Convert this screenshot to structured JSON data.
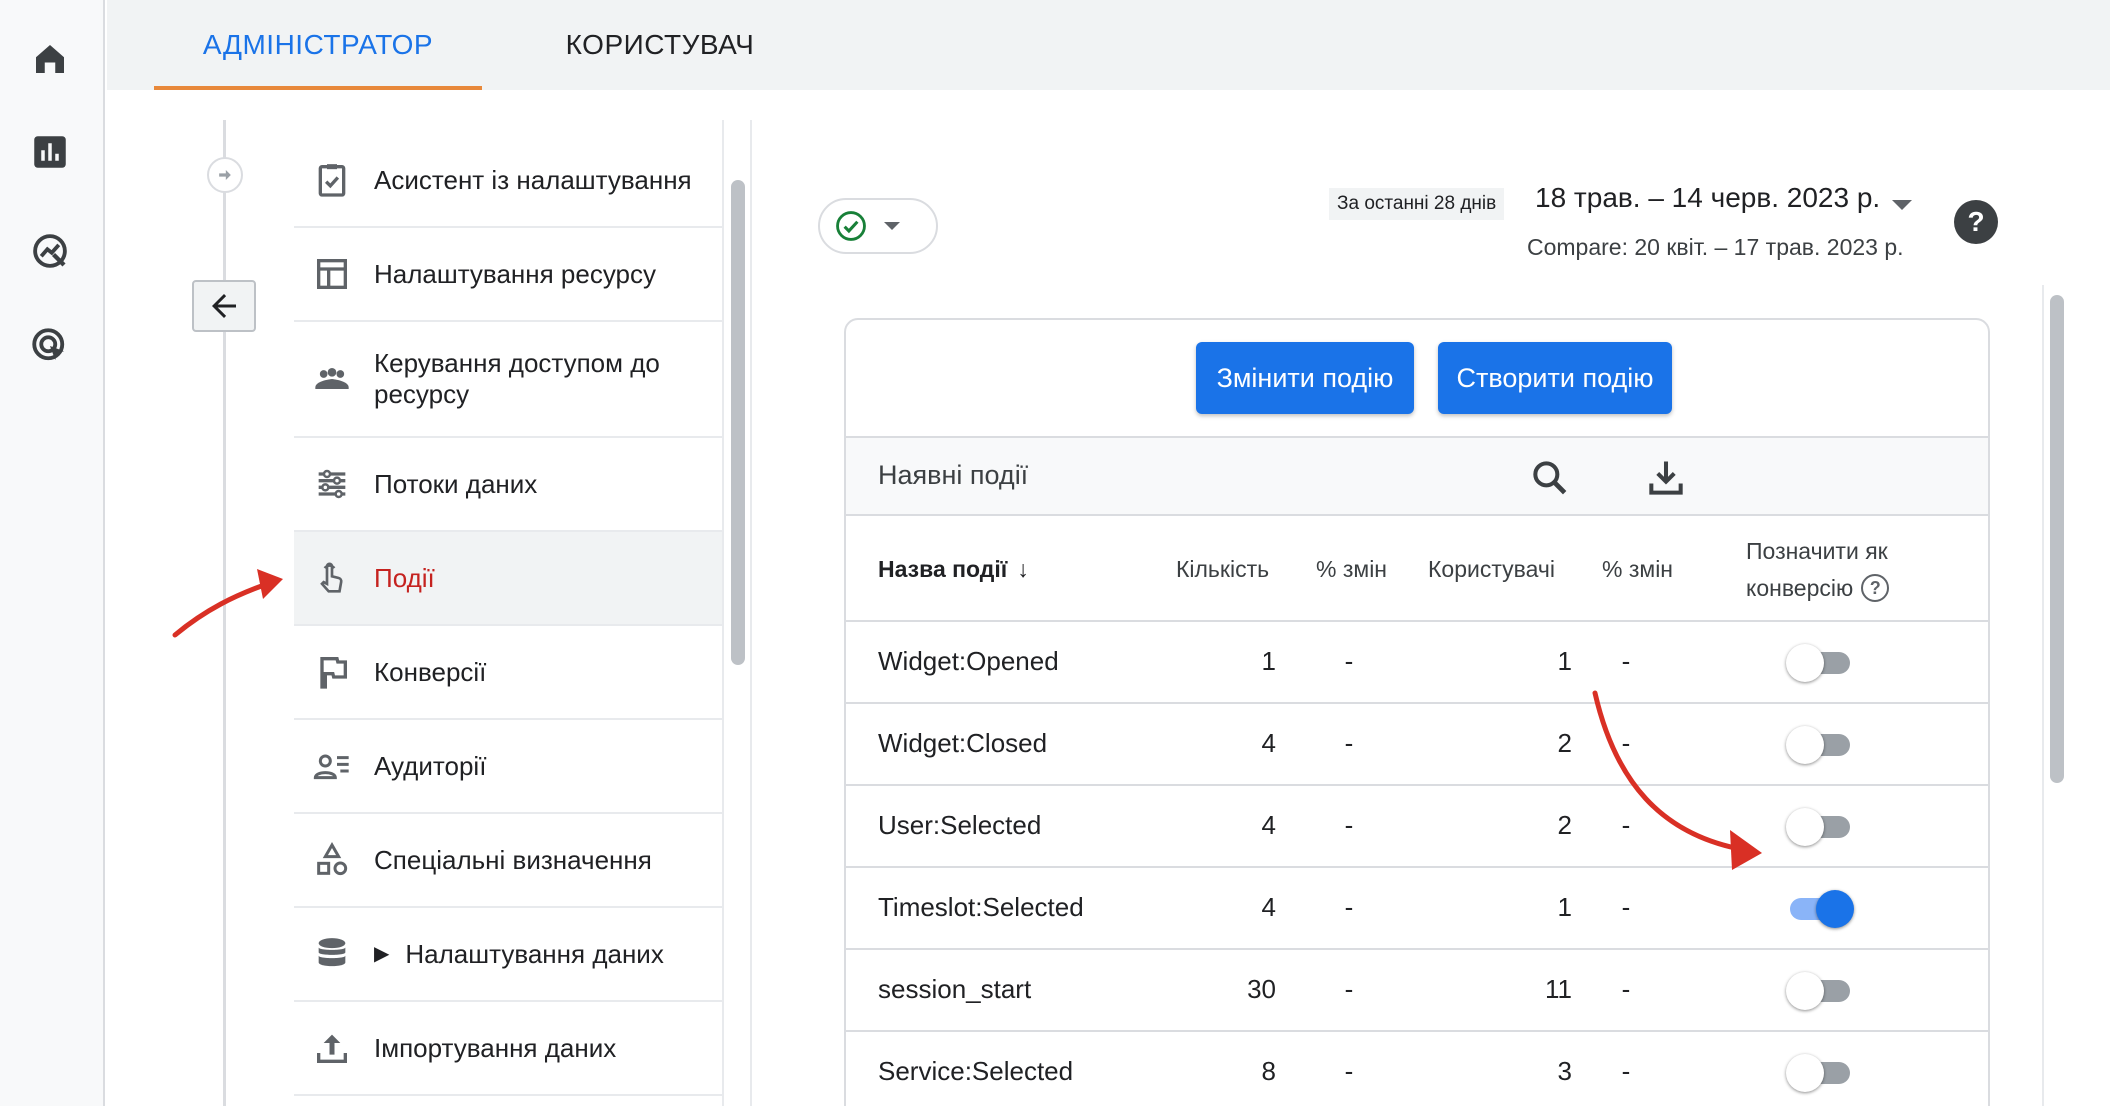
{
  "rail": {
    "items": [
      {
        "icon": "home-icon"
      },
      {
        "icon": "bar-chart-icon"
      },
      {
        "icon": "explore-icon"
      },
      {
        "icon": "advertising-icon"
      }
    ]
  },
  "tabs": [
    {
      "label": "АДМІНІСТРАТОР",
      "active": true
    },
    {
      "label": "КОРИСТУВАЧ",
      "active": false
    }
  ],
  "nav": {
    "items": [
      {
        "label": "Асистент із налаштування",
        "icon": "clipboard-check-icon"
      },
      {
        "label": "Налаштування ресурсу",
        "icon": "layout-icon"
      },
      {
        "label": "Керування доступом до ресурсу",
        "icon": "people-icon"
      },
      {
        "label": "Потоки даних",
        "icon": "data-streams-icon"
      },
      {
        "label": "Події",
        "icon": "touch-icon",
        "active": true
      },
      {
        "label": "Конверсії",
        "icon": "flag-icon"
      },
      {
        "label": "Аудиторії",
        "icon": "audience-icon"
      },
      {
        "label": "Спеціальні визначення",
        "icon": "shapes-icon"
      },
      {
        "label": "Налаштування даних",
        "icon": "database-icon",
        "expandable": true
      },
      {
        "label": "Імпортування даних",
        "icon": "upload-icon"
      }
    ]
  },
  "date": {
    "preset": "За останні 28 днів",
    "range": "18 трав. – 14 черв. 2023 р.",
    "compare": "Compare: 20 квіт. – 17 трав. 2023 р."
  },
  "card": {
    "edit_button": "Змінити подію",
    "create_button": "Створити подію",
    "title": "Наявні події"
  },
  "table": {
    "headers": {
      "name": "Назва події",
      "count": "Кількість",
      "count_change": "% змін",
      "users": "Користувачі",
      "users_change": "% змін",
      "conversion_line1": "Позначити як",
      "conversion_line2": "конверсію"
    },
    "rows": [
      {
        "name": "Widget:Opened",
        "count": "1",
        "count_change": "-",
        "users": "1",
        "users_change": "-",
        "conversion": false
      },
      {
        "name": "Widget:Closed",
        "count": "4",
        "count_change": "-",
        "users": "2",
        "users_change": "-",
        "conversion": false
      },
      {
        "name": "User:Selected",
        "count": "4",
        "count_change": "-",
        "users": "2",
        "users_change": "-",
        "conversion": false
      },
      {
        "name": "Timeslot:Selected",
        "count": "4",
        "count_change": "-",
        "users": "1",
        "users_change": "-",
        "conversion": true
      },
      {
        "name": "session_start",
        "count": "30",
        "count_change": "-",
        "users": "11",
        "users_change": "-",
        "conversion": false
      },
      {
        "name": "Service:Selected",
        "count": "8",
        "count_change": "-",
        "users": "3",
        "users_change": "-",
        "conversion": false
      }
    ]
  },
  "colors": {
    "accent": "#1a73e8",
    "tab_underline": "#e8883a",
    "active_nav": "#c5221f",
    "annotation_arrow": "#d93025"
  }
}
